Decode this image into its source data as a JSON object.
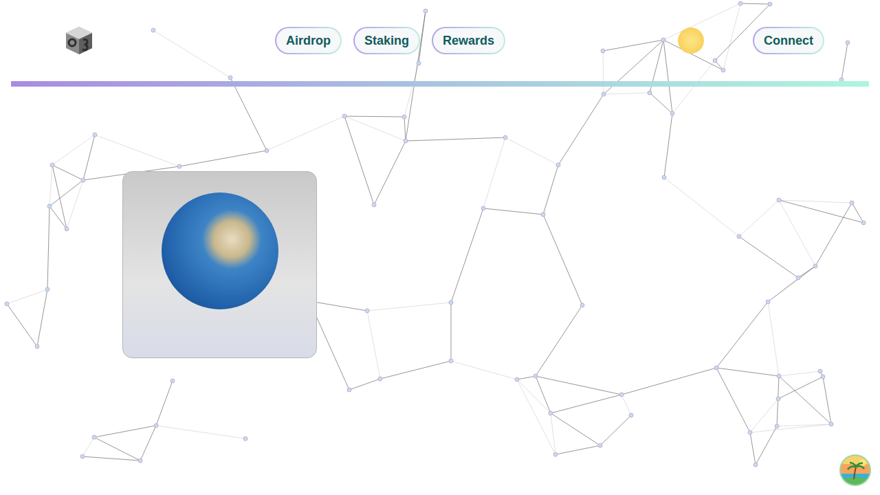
{
  "header": {
    "nav": [
      {
        "label": "Airdrop"
      },
      {
        "label": "Staking"
      },
      {
        "label": "Rewards"
      }
    ],
    "connect": {
      "label": "Connect"
    }
  }
}
